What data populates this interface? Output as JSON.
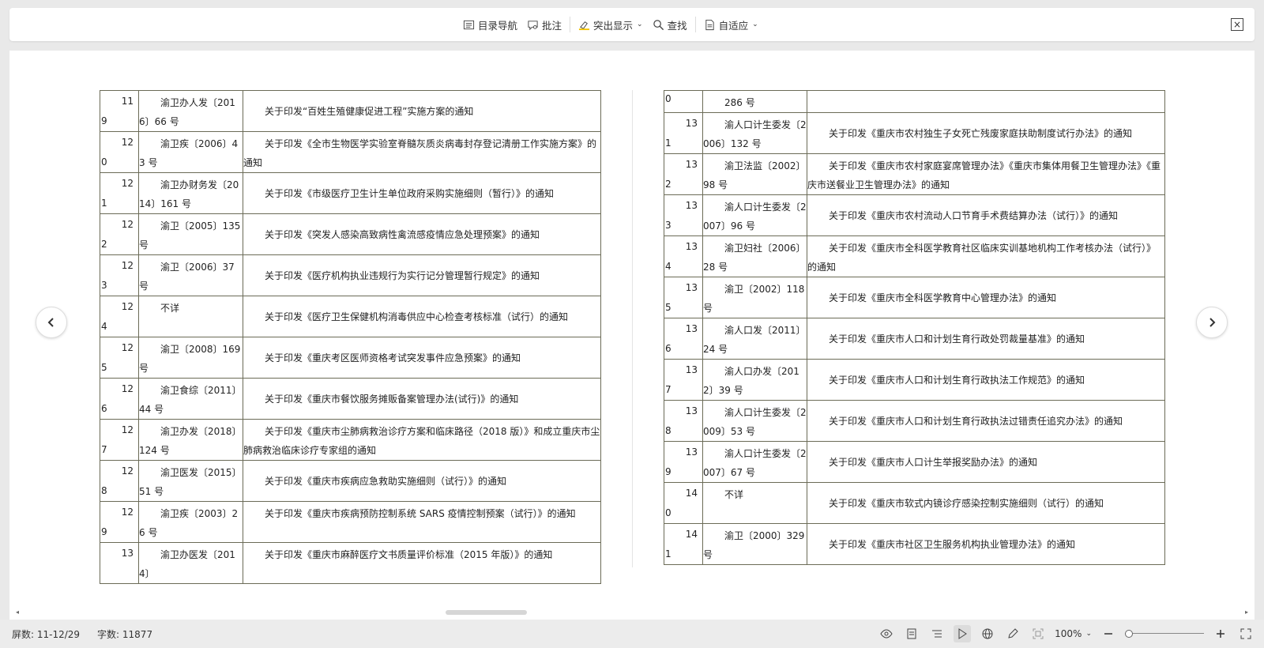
{
  "toolbar": {
    "toc_label": "目录导航",
    "comment_label": "批注",
    "highlight_label": "突出显示",
    "find_label": "查找",
    "fit_label": "自适应"
  },
  "left_table": [
    {
      "n1": "11",
      "n2": "9",
      "code": "渝卫办人发〔2016〕66 号",
      "title": "关于印发“百姓生殖健康促进工程”实施方案的通知"
    },
    {
      "n1": "12",
      "n2": "0",
      "code": "渝卫疾〔2006〕43 号",
      "title": "关于印发《全市生物医学实验室脊髓灰质炎病毒封存登记清册工作实施方案》的通知"
    },
    {
      "n1": "12",
      "n2": "1",
      "code": "渝卫办财务发〔2014〕161 号",
      "title": "关于印发《市级医疗卫生计生单位政府采购实施细则（暂行）》的通知"
    },
    {
      "n1": "12",
      "n2": "2",
      "code": "渝卫〔2005〕135 号",
      "title": "关于印发《突发人感染高致病性禽流感疫情应急处理预案》的通知"
    },
    {
      "n1": "12",
      "n2": "3",
      "code": "渝卫〔2006〕37 号",
      "title": "关于印发《医疗机构执业违规行为实行记分管理暂行规定》的通知"
    },
    {
      "n1": "12",
      "n2": "4",
      "code": "不详",
      "title": "关于印发《医疗卫生保健机构消毒供应中心检查考核标准（试行）的通知"
    },
    {
      "n1": "12",
      "n2": "5",
      "code": "渝卫〔2008〕169 号",
      "title": "关于印发《重庆考区医师资格考试突发事件应急预案》的通知"
    },
    {
      "n1": "12",
      "n2": "6",
      "code": "渝卫食综〔2011〕44 号",
      "title": "关于印发《重庆市餐饮服务摊贩备案管理办法(试行)》的通知"
    },
    {
      "n1": "12",
      "n2": "7",
      "code": "渝卫办发〔2018〕124 号",
      "title": "关于印发《重庆市尘肺病救治诊疗方案和临床路径（2018 版）》和成立重庆市尘肺病救治临床诊疗专家组的通知"
    },
    {
      "n1": "12",
      "n2": "8",
      "code": "渝卫医发〔2015〕51 号",
      "title": "关于印发《重庆市疾病应急救助实施细则（试行）》的通知"
    },
    {
      "n1": "12",
      "n2": "9",
      "code": "渝卫疾〔2003〕26 号",
      "title": "关于印发《重庆市疾病预防控制系统 SARS 疫情控制预案（试行）》的通知"
    },
    {
      "n1": "13",
      "n2": "",
      "code": "渝卫办医发〔2014〕",
      "title": "关于印发《重庆市麻醉医疗文书质量评价标准（2015 年版）》的通知"
    }
  ],
  "right_table": [
    {
      "n1": "",
      "n2": "0",
      "code": "286 号",
      "title": ""
    },
    {
      "n1": "13",
      "n2": "1",
      "code": "渝人口计生委发〔2006〕132 号",
      "title": "关于印发《重庆市农村独生子女死亡残废家庭扶助制度试行办法》的通知"
    },
    {
      "n1": "13",
      "n2": "2",
      "code": "渝卫法监〔2002〕98 号",
      "title": "关于印发《重庆市农村家庭宴席管理办法》《重庆市集体用餐卫生管理办法》《重庆市送餐业卫生管理办法》的通知"
    },
    {
      "n1": "13",
      "n2": "3",
      "code": "渝人口计生委发〔2007〕96 号",
      "title": "关于印发《重庆市农村流动人口节育手术费结算办法（试行）》的通知"
    },
    {
      "n1": "13",
      "n2": "4",
      "code": "渝卫妇社〔2006〕28 号",
      "title": "关于印发《重庆市全科医学教育社区临床实训基地机构工作考核办法（试行）》的通知"
    },
    {
      "n1": "13",
      "n2": "5",
      "code": "渝卫〔2002〕118 号",
      "title": "关于印发《重庆市全科医学教育中心管理办法》的通知"
    },
    {
      "n1": "13",
      "n2": "6",
      "code": "渝人口发〔2011〕24 号",
      "title": "关于印发《重庆市人口和计划生育行政处罚裁量基准》的通知"
    },
    {
      "n1": "13",
      "n2": "7",
      "code": "渝人口办发〔2012〕39 号",
      "title": "关于印发《重庆市人口和计划生育行政执法工作规范》的通知"
    },
    {
      "n1": "13",
      "n2": "8",
      "code": "渝人口计生委发〔2009〕53 号",
      "title": "关于印发《重庆市人口和计划生育行政执法过错责任追究办法》的通知"
    },
    {
      "n1": "13",
      "n2": "9",
      "code": "渝人口计生委发〔2007〕67 号",
      "title": "关于印发《重庆市人口计生举报奖励办法》的通知"
    },
    {
      "n1": "14",
      "n2": "0",
      "code": "不详",
      "title": "关于印发《重庆市软式内镜诊疗感染控制实施细则（试行）的通知"
    },
    {
      "n1": "14",
      "n2": "1",
      "code": "渝卫〔2000〕329 号",
      "title": "关于印发《重庆市社区卫生服务机构执业管理办法》的通知"
    }
  ],
  "status": {
    "screen_label": "屏数: 11-12/29",
    "word_count_label": "字数: 11877",
    "zoom": "100%"
  }
}
